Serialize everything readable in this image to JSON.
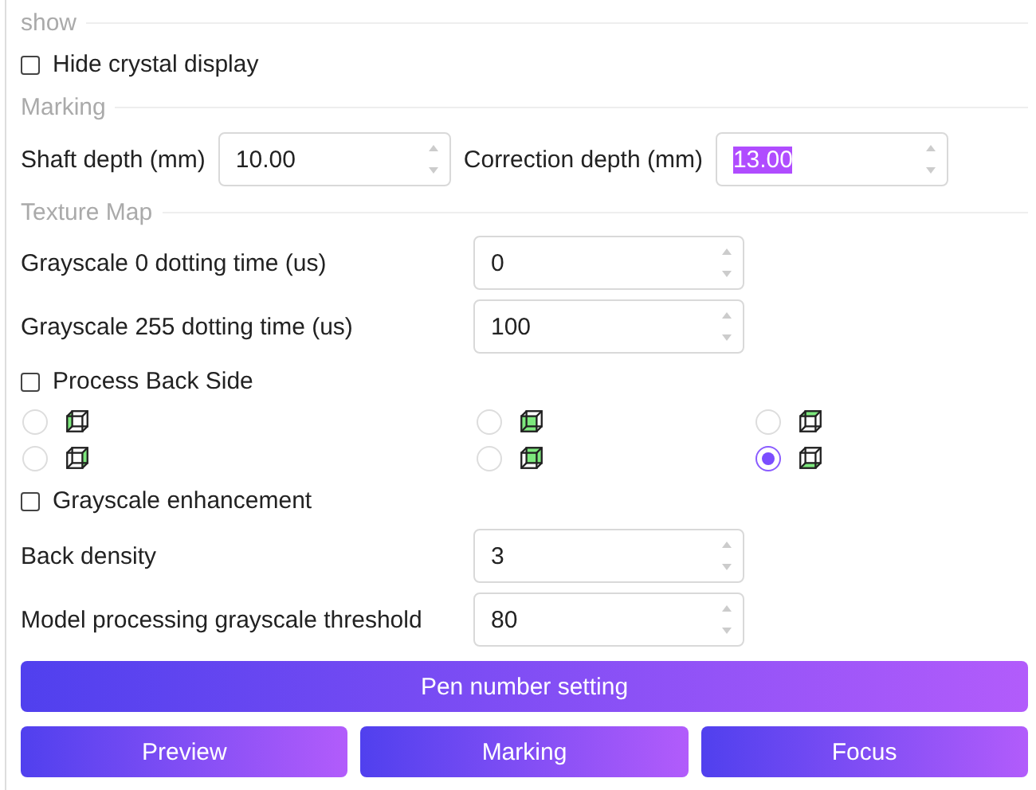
{
  "sections": [
    {
      "kind": "show",
      "legend": "show",
      "items": [
        {
          "kind": "checkbox",
          "label": "Hide crystal display",
          "checked": false
        }
      ]
    },
    {
      "kind": "marking",
      "legend": "Marking",
      "fields": [
        {
          "label": "Shaft depth (mm)",
          "value": "10.00",
          "highlighted": false
        },
        {
          "label": "Correction depth (mm)",
          "value": "13.00",
          "highlighted": true
        }
      ]
    },
    {
      "kind": "texture",
      "legend": "Texture Map",
      "items": [
        {
          "kind": "field",
          "label": "Grayscale 0 dotting time (us)",
          "value": "0"
        },
        {
          "kind": "field",
          "label": "Grayscale 255 dotting time (us)",
          "value": "100"
        },
        {
          "kind": "checkbox",
          "label": "Process Back Side",
          "checked": false
        },
        {
          "kind": "faces",
          "options": [
            {
              "kind": "left",
              "selected": false
            },
            {
              "kind": "front",
              "selected": false
            },
            {
              "kind": "top",
              "selected": false
            },
            {
              "kind": "right",
              "selected": false
            },
            {
              "kind": "back",
              "selected": false
            },
            {
              "kind": "bottom",
              "selected": true
            }
          ]
        },
        {
          "kind": "checkbox",
          "label": "Grayscale enhancement",
          "checked": false
        },
        {
          "kind": "field",
          "label": "Back density",
          "value": "3"
        },
        {
          "kind": "field",
          "label": "Model processing grayscale threshold",
          "value": "80"
        }
      ]
    }
  ],
  "wide_button": "Pen number setting",
  "buttons": [
    "Preview",
    "Marking",
    "Focus"
  ]
}
